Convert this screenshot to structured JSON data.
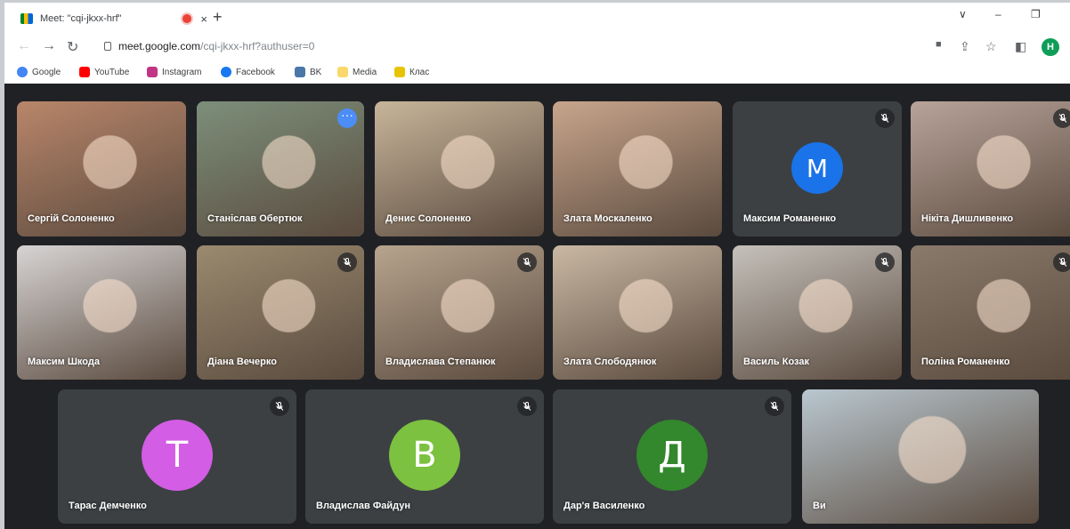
{
  "browser": {
    "tab_title": "Meet: \"cqi-jkxx-hrf\"",
    "tab_close": "×",
    "new_tab": "+",
    "win_controls": [
      "∨",
      "–",
      "❐"
    ],
    "url_host": "meet.google.com",
    "url_path": "/cqi-jkxx-hrf?authuser=0",
    "profile_initial": "H",
    "bookmarks": [
      {
        "label": "Google",
        "color": "#4285f4"
      },
      {
        "label": "YouTube",
        "color": "#ff0000"
      },
      {
        "label": "Instagram",
        "color": "#c13584"
      },
      {
        "label": "Facebook",
        "color": "#1877f2"
      },
      {
        "label": "BK",
        "color": "#4a76a8"
      },
      {
        "label": "Media",
        "color": "#f9d96b"
      },
      {
        "label": "Клас",
        "color": "#e8c400"
      }
    ]
  },
  "meet": {
    "participants": [
      {
        "name": "Сергій Солоненко",
        "bg": "#b9866a",
        "muted": false
      },
      {
        "name": "Станіслав Обертюк",
        "bg": "#7c8f7a",
        "muted": false,
        "active": true
      },
      {
        "name": "Денис Солоненко",
        "bg": "#c7b59a",
        "muted": false
      },
      {
        "name": "Злата Москаленко",
        "bg": "#c8a58c",
        "muted": false
      },
      {
        "name": "Максим Романенко",
        "bg": "#3c4043",
        "muted": true,
        "initial": "М",
        "avatar_color": "#1a73e8"
      },
      {
        "name": "Нікіта Дишливенко",
        "bg": "#b8a39a",
        "muted": true
      },
      {
        "name": "Максим Шкода",
        "bg": "#d7d4d4",
        "muted": false
      },
      {
        "name": "Діана Вечерко",
        "bg": "#9a8a6f",
        "muted": true
      },
      {
        "name": "Владислава Степанюк",
        "bg": "#b7a48e",
        "muted": true
      },
      {
        "name": "Злата Слободянюк",
        "bg": "#c9b8a3",
        "muted": false
      },
      {
        "name": "Василь Козак",
        "bg": "#c5c1bb",
        "muted": true
      },
      {
        "name": "Поліна Романенко",
        "bg": "#8a7a6b",
        "muted": true
      },
      {
        "name": "Тарас Демченко",
        "bg": "#3c4043",
        "muted": true,
        "initial": "Т",
        "avatar_color": "#d35de4"
      },
      {
        "name": "Владислав Файдун",
        "bg": "#3c4043",
        "muted": true,
        "initial": "В",
        "avatar_color": "#7cc13f"
      },
      {
        "name": "Дар'я Василенко",
        "bg": "#3c4043",
        "muted": true,
        "initial": "Д",
        "avatar_color": "#33872c"
      },
      {
        "name": "Ви",
        "bg": "#b9c7cf",
        "muted": false
      }
    ]
  }
}
